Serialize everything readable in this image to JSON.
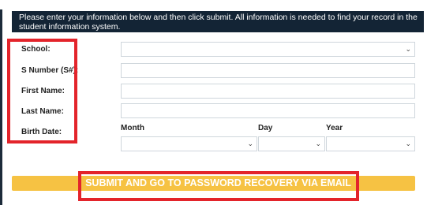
{
  "header_text": "Please enter your information below and then click submit. All information is needed to find your record in the student information system.",
  "fields": {
    "school": {
      "label": "School:",
      "value": ""
    },
    "snumber": {
      "label": "S Number (S#):",
      "value": ""
    },
    "first_name": {
      "label": "First Name:",
      "value": ""
    },
    "last_name": {
      "label": "Last Name:",
      "value": ""
    },
    "birth_date": {
      "label": "Birth Date:",
      "month_label": "Month",
      "day_label": "Day",
      "year_label": "Year",
      "month_value": "",
      "day_value": "",
      "year_value": ""
    }
  },
  "submit_label": "SUBMIT AND GO TO PASSWORD RECOVERY VIA EMAIL",
  "colors": {
    "header_bg": "#132435",
    "submit_bg": "#f6c243",
    "highlight": "#e3242b"
  }
}
